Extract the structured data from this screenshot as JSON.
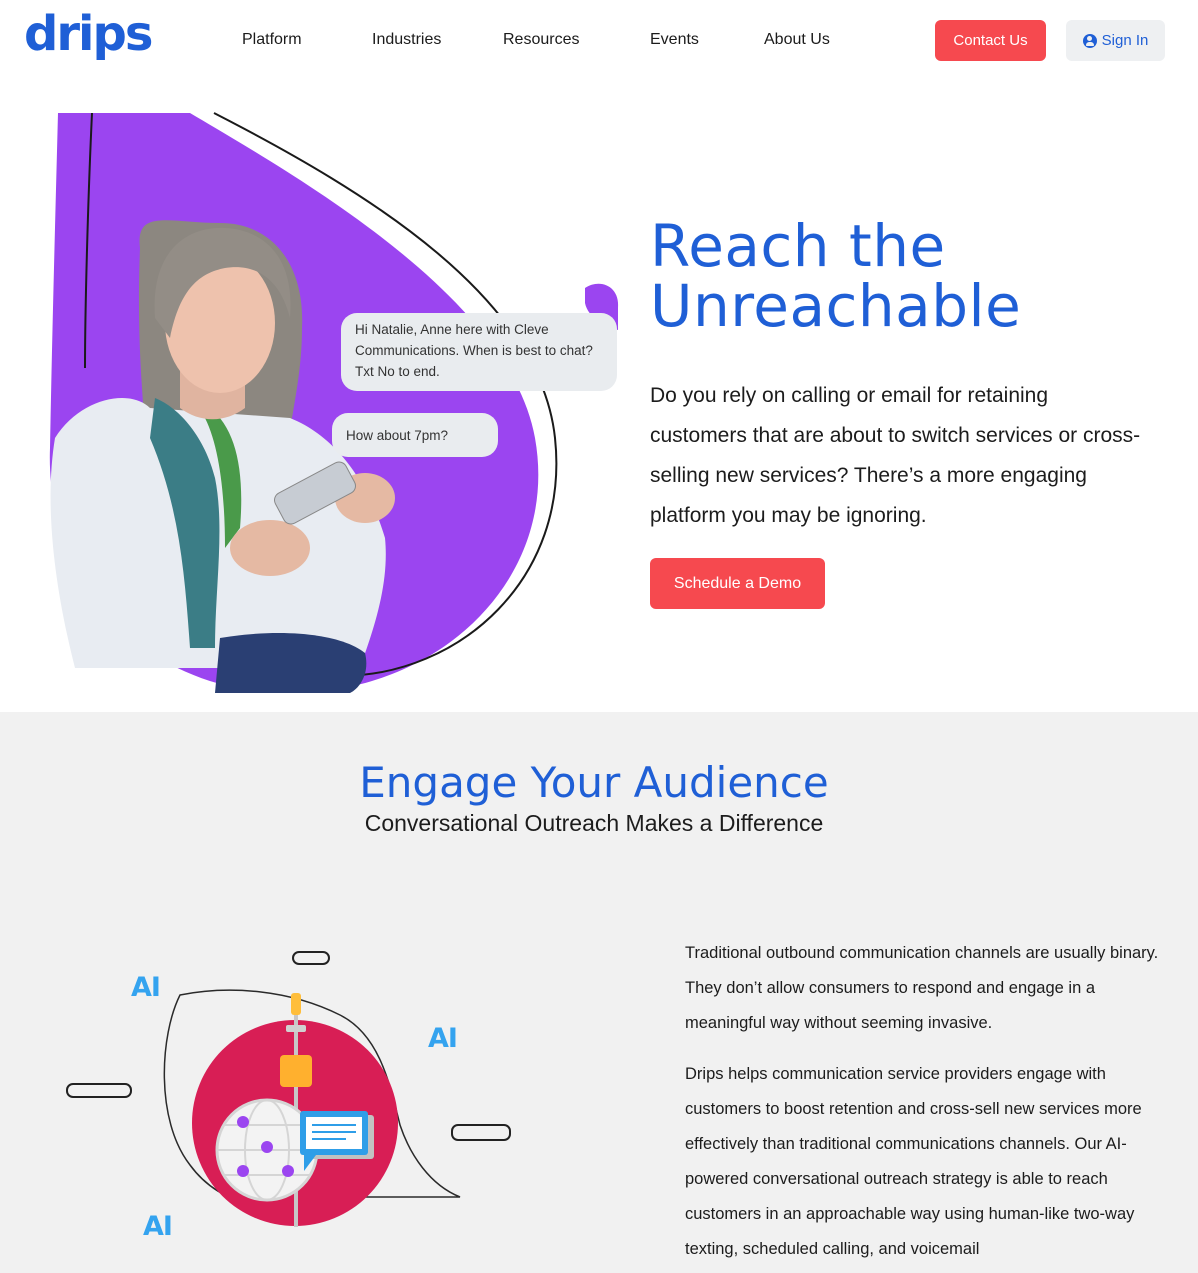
{
  "brand": {
    "logo_text": "drips",
    "primary_color": "#1f5fd6",
    "accent_color": "#f6494f",
    "purple": "#9b45f0"
  },
  "nav": {
    "items": [
      "Platform",
      "Industries",
      "Resources",
      "Events",
      "About Us"
    ],
    "contact_label": "Contact Us",
    "signin_label": "Sign In",
    "signin_icon": "user-circle-icon"
  },
  "hero": {
    "title_line1": "Reach the",
    "title_line2": "Unreachable",
    "copy": "Do you rely on calling or email for retaining customers that are about to switch services or cross-selling new services? There’s a more engaging platform you may be ignoring.",
    "cta_label": "Schedule a Demo",
    "chat": {
      "message_1": "Hi Natalie, Anne here with Cleve Communications. When is best to chat? Txt No to end.",
      "message_2": "How about 7pm?"
    }
  },
  "section2": {
    "title": "Engage Your Audience",
    "subtitle": "Conversational Outreach Makes a Difference",
    "paragraph_1": "Traditional outbound communication channels are usually binary. They don’t allow consumers to respond and engage in a meaningful way without seeming invasive.",
    "paragraph_2": "Drips helps communication service providers engage with customers to boost retention and cross-sell new services more effectively than traditional communications channels. Our AI-powered conversational outreach strategy is able to reach customers in an approachable way using human-like two-way texting, scheduled calling, and voicemail",
    "illustration_labels": [
      "AI",
      "AI",
      "AI"
    ]
  }
}
